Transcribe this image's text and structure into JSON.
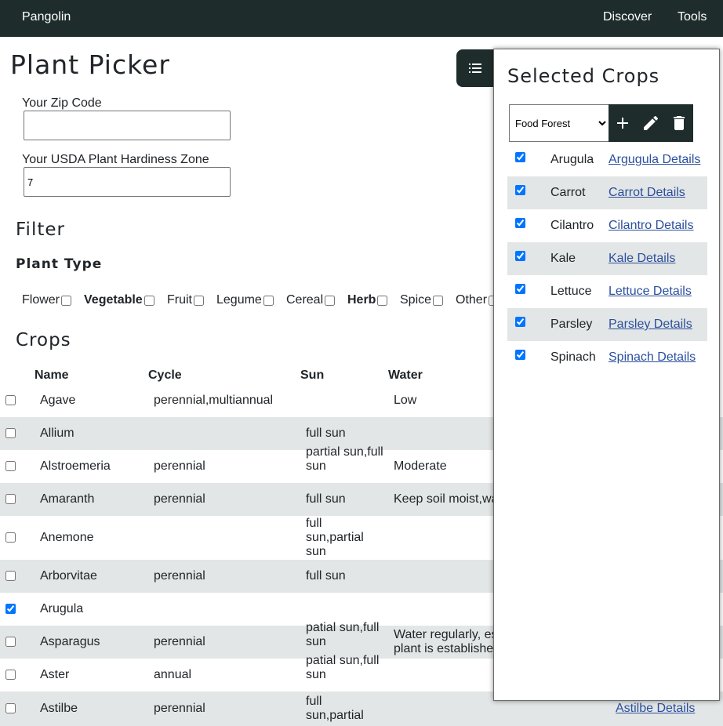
{
  "nav": {
    "brand": "Pangolin",
    "links": [
      "Discover",
      "Tools"
    ]
  },
  "page": {
    "title": "Plant Picker",
    "zip_label": "Your Zip Code",
    "zip_value": "",
    "zone_label": "Your USDA Plant Hardiness Zone",
    "zone_value": "7"
  },
  "filter": {
    "heading": "Filter",
    "type_heading": "Plant Type",
    "types": [
      {
        "label": "Flower",
        "bold": false,
        "checked": false
      },
      {
        "label": "Vegetable",
        "bold": true,
        "checked": false
      },
      {
        "label": "Fruit",
        "bold": false,
        "checked": false
      },
      {
        "label": "Legume",
        "bold": false,
        "checked": false
      },
      {
        "label": "Cereal",
        "bold": false,
        "checked": false
      },
      {
        "label": "Herb",
        "bold": true,
        "checked": false
      },
      {
        "label": "Spice",
        "bold": false,
        "checked": false
      },
      {
        "label": "Other",
        "bold": false,
        "checked": false
      }
    ]
  },
  "crops": {
    "heading": "Crops",
    "columns": [
      "Name",
      "Cycle",
      "Sun",
      "Water"
    ],
    "rows": [
      {
        "name": "Agave",
        "cycle": "perennial,multiannual",
        "sun": "",
        "water": "Low",
        "checked": false,
        "link": ""
      },
      {
        "name": "Allium",
        "cycle": "",
        "sun": "full sun",
        "water": "",
        "checked": false,
        "link": ""
      },
      {
        "name": "Alstroemeria",
        "cycle": "perennial",
        "sun": "partial sun,full sun",
        "water": "Moderate",
        "checked": false,
        "link": ""
      },
      {
        "name": "Amaranth",
        "cycle": "perennial",
        "sun": "full sun",
        "water": "Keep soil moist,wa",
        "checked": false,
        "link": ""
      },
      {
        "name": "Anemone",
        "cycle": "",
        "sun": "full sun,partial sun",
        "water": "",
        "checked": false,
        "link": ""
      },
      {
        "name": "Arborvitae",
        "cycle": "perennial",
        "sun": "full sun",
        "water": "",
        "checked": false,
        "link": ""
      },
      {
        "name": "Arugula",
        "cycle": "",
        "sun": "",
        "water": "",
        "checked": true,
        "link": ""
      },
      {
        "name": "Asparagus",
        "cycle": "perennial",
        "sun": "patial sun,full sun",
        "water": "Water regularly, es plant is establishe",
        "checked": false,
        "link": ""
      },
      {
        "name": "Aster",
        "cycle": "annual",
        "sun": "patial sun,full sun",
        "water": "",
        "checked": false,
        "link": ""
      },
      {
        "name": "Astilbe",
        "cycle": "perennial",
        "sun": "full sun,partial",
        "water": "",
        "checked": false,
        "link": "Astilbe Details"
      }
    ]
  },
  "panel": {
    "title": "Selected Crops",
    "select_value": "Food Forest",
    "tools": [
      "plus-icon",
      "pencil-icon",
      "trash-icon"
    ],
    "items": [
      {
        "name": "Arugula",
        "link": "Argugula Details"
      },
      {
        "name": "Carrot",
        "link": "Carrot Details"
      },
      {
        "name": "Cilantro",
        "link": "Cilantro Details"
      },
      {
        "name": "Kale",
        "link": "Kale Details"
      },
      {
        "name": "Lettuce",
        "link": "Lettuce Details"
      },
      {
        "name": "Parsley",
        "link": "Parsley Details"
      },
      {
        "name": "Spinach",
        "link": "Spinach Details"
      }
    ]
  },
  "colors": {
    "nav_bg": "#1e2d2b",
    "row_alt": "#e3e6e6",
    "link": "#2b4f9e"
  }
}
